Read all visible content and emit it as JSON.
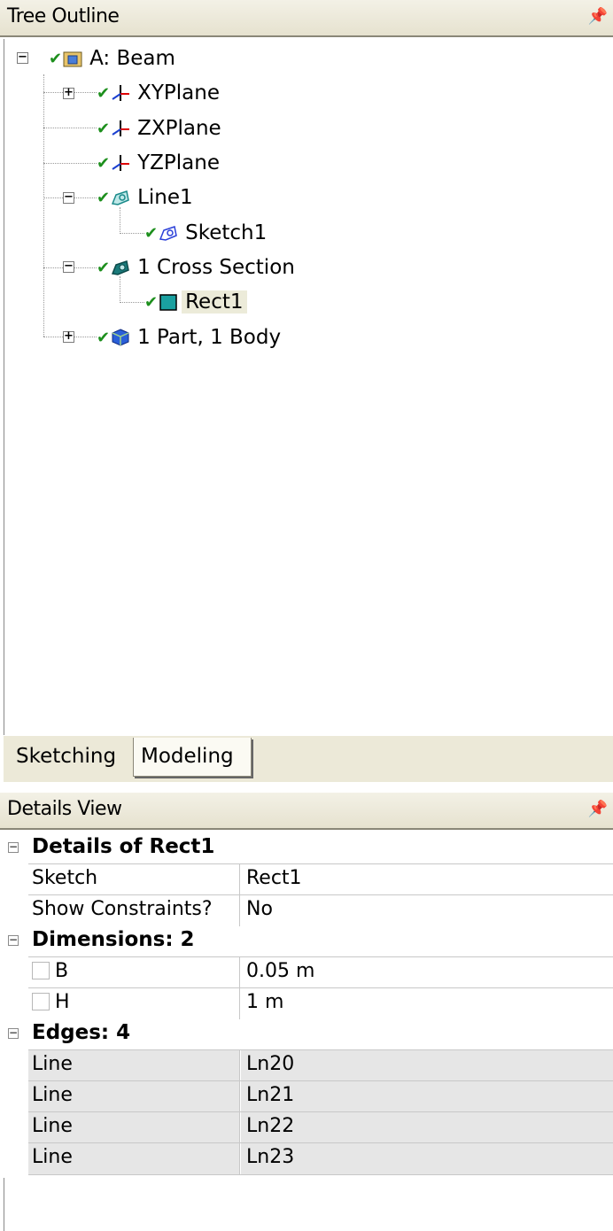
{
  "tree_outline": {
    "title": "Tree Outline",
    "pin": "⌂",
    "nodes": [
      {
        "label": "A: Beam"
      },
      {
        "label": "XYPlane"
      },
      {
        "label": "ZXPlane"
      },
      {
        "label": "YZPlane"
      },
      {
        "label": "Line1"
      },
      {
        "label": "Sketch1"
      },
      {
        "label": "1 Cross Section"
      },
      {
        "label": "Rect1"
      },
      {
        "label": "1 Part, 1 Body"
      }
    ]
  },
  "tabs": [
    "Sketching",
    "Modeling"
  ],
  "details_view": {
    "title": "Details View",
    "groups": [
      {
        "title": "Details of Rect1",
        "rows": [
          {
            "key": "Sketch",
            "value": "Rect1"
          },
          {
            "key": "Show Constraints?",
            "value": "No"
          }
        ]
      },
      {
        "title": "Dimensions: 2",
        "rows": [
          {
            "key": "B",
            "value": "0.05 m"
          },
          {
            "key": "H",
            "value": "1 m"
          }
        ]
      },
      {
        "title": "Edges: 4",
        "rows": [
          {
            "key": "Line",
            "value": "Ln20"
          },
          {
            "key": "Line",
            "value": "Ln21"
          },
          {
            "key": "Line",
            "value": "Ln22"
          },
          {
            "key": "Line",
            "value": "Ln23"
          }
        ]
      }
    ]
  }
}
